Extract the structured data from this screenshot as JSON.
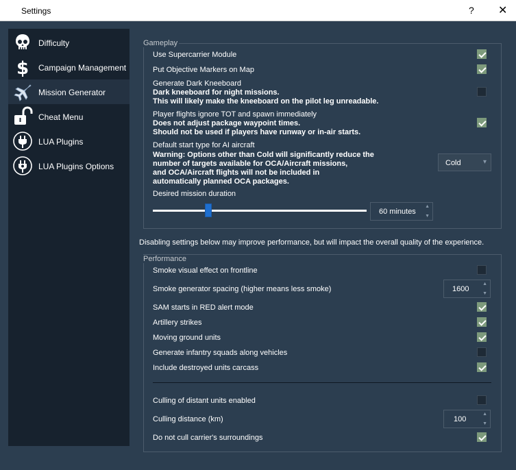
{
  "window": {
    "title": "Settings",
    "help": "?",
    "close": "✕"
  },
  "sidebar": {
    "items": [
      {
        "label": "Difficulty",
        "icon": "skull-icon"
      },
      {
        "label": "Campaign Management",
        "icon": "dollar-icon"
      },
      {
        "label": "Mission Generator",
        "icon": "jet-icon"
      },
      {
        "label": "Cheat Menu",
        "icon": "unlocked-padlock-icon"
      },
      {
        "label": "LUA Plugins",
        "icon": "plug-icon"
      },
      {
        "label": "LUA Plugins Options",
        "icon": "plug-settings-icon"
      }
    ],
    "selected": "Mission Generator"
  },
  "gameplay": {
    "title": "Gameplay",
    "supercarrier": {
      "label": "Use Supercarrier Module",
      "checked": true
    },
    "markers": {
      "label": "Put Objective Markers on Map",
      "checked": true
    },
    "kneeboard": {
      "label": "Generate Dark Kneeboard",
      "desc1": "Dark kneeboard for night missions.",
      "desc2": "This will likely make the kneeboard on the pilot leg unreadable.",
      "checked": false
    },
    "tot": {
      "label": "Player flights ignore TOT and spawn immediately",
      "desc1": "Does not adjust package waypoint times.",
      "desc2": "Should not be used if players have runway or in-air starts.",
      "checked": true
    },
    "start_type": {
      "label": "Default start type for AI aircraft",
      "desc1": "Warning: Options other than Cold will significantly reduce the",
      "desc2": "number of targets available for OCA/Aircraft missions,",
      "desc3": "and OCA/Aircraft flights will not be included in",
      "desc4": "automatically planned OCA packages.",
      "value": "Cold"
    },
    "duration": {
      "label": "Desired mission duration",
      "value": "60 minutes",
      "slider_fraction": 0.26
    }
  },
  "perf_note": "Disabling settings below may improve performance, but will impact the overall quality of the experience.",
  "performance": {
    "title": "Performance",
    "smoke": {
      "label": "Smoke visual effect on frontline",
      "checked": false
    },
    "smoke_spacing": {
      "label": "Smoke generator spacing (higher means less smoke)",
      "value": "1600"
    },
    "sam": {
      "label": "SAM starts in RED alert mode",
      "checked": true
    },
    "artillery": {
      "label": "Artillery strikes",
      "checked": true
    },
    "moving": {
      "label": "Moving ground units",
      "checked": true
    },
    "infantry": {
      "label": "Generate infantry squads along vehicles",
      "checked": false
    },
    "carcass": {
      "label": "Include destroyed units carcass",
      "checked": true
    },
    "culling": {
      "label": "Culling of distant units enabled",
      "checked": false
    },
    "culling_distance": {
      "label": "Culling distance (km)",
      "value": "100"
    },
    "carrier": {
      "label": "Do not cull carrier's surroundings",
      "checked": true
    }
  }
}
